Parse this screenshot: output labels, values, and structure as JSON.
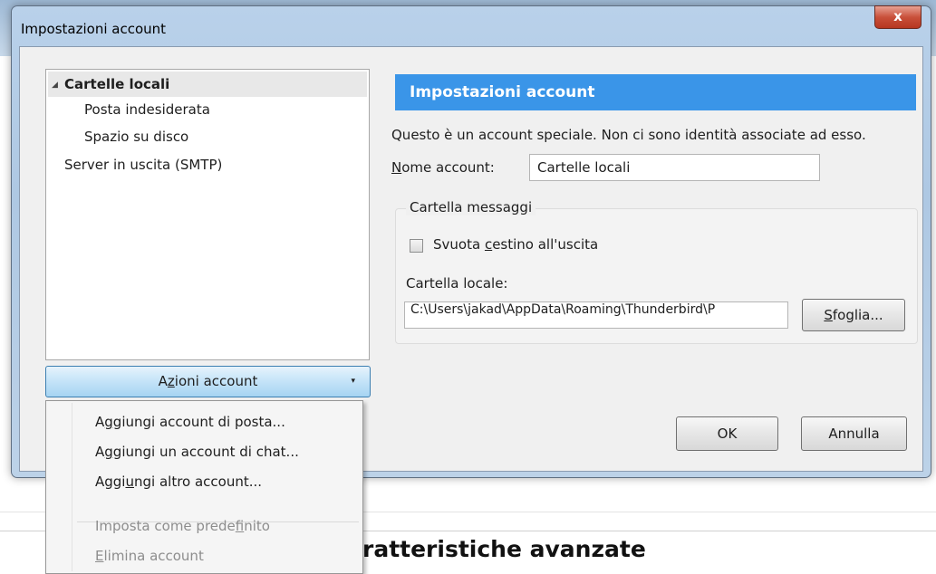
{
  "background": {
    "heading": "ratteristiche avanzate"
  },
  "window": {
    "title": "Impostazioni account",
    "close_label": "x"
  },
  "tree": {
    "items": [
      {
        "label": "Cartelle locali",
        "expander": "◢"
      },
      {
        "label": "Posta indesiderata"
      },
      {
        "label": "Spazio su disco"
      },
      {
        "label": "Server in uscita (SMTP)"
      }
    ]
  },
  "account_actions": {
    "label_pre": "A",
    "label_accel": "z",
    "label_post": "ioni account",
    "arrow": "▾"
  },
  "panel": {
    "header": "Impostazioni account",
    "description": "Questo è un account speciale. Non ci sono identità associate ad esso.",
    "name_label_accel": "N",
    "name_label_rest": "ome account:",
    "name_value": "Cartelle locali",
    "group_title": "Cartella messaggi",
    "empty_trash_pre": "Svuota ",
    "empty_trash_accel": "c",
    "empty_trash_post": "estino all'uscita",
    "empty_trash_checked": false,
    "local_folder_label": "Cartella locale:",
    "local_folder_value": "C:\\Users\\jakad\\AppData\\Roaming\\Thunderbird\\P",
    "browse_accel": "S",
    "browse_rest": "foglia..."
  },
  "buttons": {
    "ok": "OK",
    "cancel": "Annulla"
  },
  "menu": {
    "add_mail_pre": "A",
    "add_mail_accel": "g",
    "add_mail_post": "giungi account di posta...",
    "add_chat_pre": "A",
    "add_chat_accel": "g",
    "add_chat_post": "giungi un account di chat...",
    "add_other_pre": "Aggi",
    "add_other_accel": "u",
    "add_other_post": "ngi altro account...",
    "set_default_pre": "Imposta come prede",
    "set_default_accel": "f",
    "set_default_post": "inito",
    "remove_accel": "E",
    "remove_post": "limina account"
  }
}
